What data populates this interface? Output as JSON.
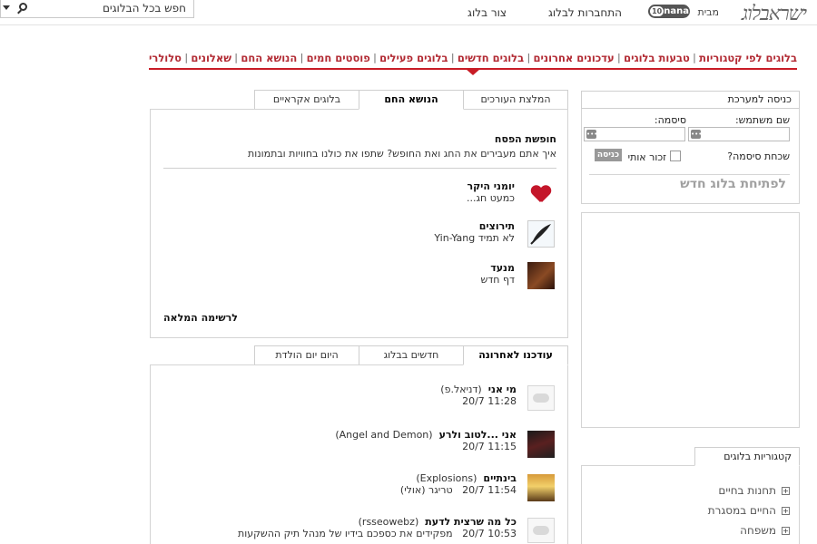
{
  "topbar": {
    "logo": "ישראבלוג",
    "by": "מבית",
    "nana": "nana",
    "nana_suffix": "10",
    "login_link": "התחברות לבלוג",
    "create_link": "צור בלוג",
    "search_label": "חפש בכל הבלוגים"
  },
  "nav": {
    "items": [
      "בלוגים לפי קטגוריות",
      "טבעות בלוגים",
      "עדכונים אחרונים",
      "בלוגים חדשים",
      "בלוגים פעילים",
      "פוסטים חמים",
      "הנושא החם",
      "שאלונים",
      "סלולרי"
    ],
    "separator": "|",
    "accent_color": "#c81c26"
  },
  "hot": {
    "tabs": [
      "המלצת העורכים",
      "הנושא החם",
      "בלוגים אקראיים"
    ],
    "active_tab": "הנושא החם",
    "title": "חופשת הפסח",
    "description": "איך אתם מעבירים את החג ואת החופש? שתפו את כולנו בחוויות ובתמונות",
    "entries": [
      {
        "name": "יומני היקר",
        "sub": "כמעט חג...",
        "icon": "heart-icon"
      },
      {
        "name": "תירוצים",
        "sub": "לא תמיד Yin-Yang",
        "icon": "quill-icon"
      },
      {
        "name": "מנעד",
        "sub": "דף חדש",
        "icon": "portrait-thumbnail"
      }
    ],
    "full_list": "לרשימה המלאה"
  },
  "updates": {
    "tabs": [
      "עודכנו לאחרונה",
      "חדשים בבלוג",
      "היום יום הולדת"
    ],
    "active_tab": "עודכנו לאחרונה",
    "entries": [
      {
        "title": "מי אני",
        "author": "(דניאל.פ)",
        "time": "11:28 20/7",
        "extra": "",
        "icon": "speech-bubble-icon"
      },
      {
        "title": "אני ...לטוב ולרע",
        "author": "(Angel and Demon)",
        "time": "11:15 20/7",
        "extra": "",
        "icon": "dark-thumbnail"
      },
      {
        "title": "בינתיים",
        "author": "(Explosions)",
        "time": "11:54 20/7",
        "extra": "טריגר (אולי)",
        "icon": "sunset-thumbnail"
      },
      {
        "title": "כל מה שרצית לדעת",
        "author": "(rsseowebz)",
        "time": "10:53 20/7",
        "extra": "מפקידים את כספכם בידיו של מנהל תיק ההשקעות",
        "icon": "speech-bubble-icon"
      }
    ]
  },
  "login": {
    "header": "כניסה למערכת",
    "username_label": "שם משתמש:",
    "password_label": "סיסמה:",
    "forgot": "שכחת סיסמה?",
    "remember": "זכור אותי",
    "button": "כניסה",
    "open_blog": "לפתיחת בלוג חדש"
  },
  "categories": {
    "header": "קטגוריות בלוגים",
    "items": [
      "תחנות בחיים",
      "החיים במסגרת",
      "משפחה"
    ]
  }
}
